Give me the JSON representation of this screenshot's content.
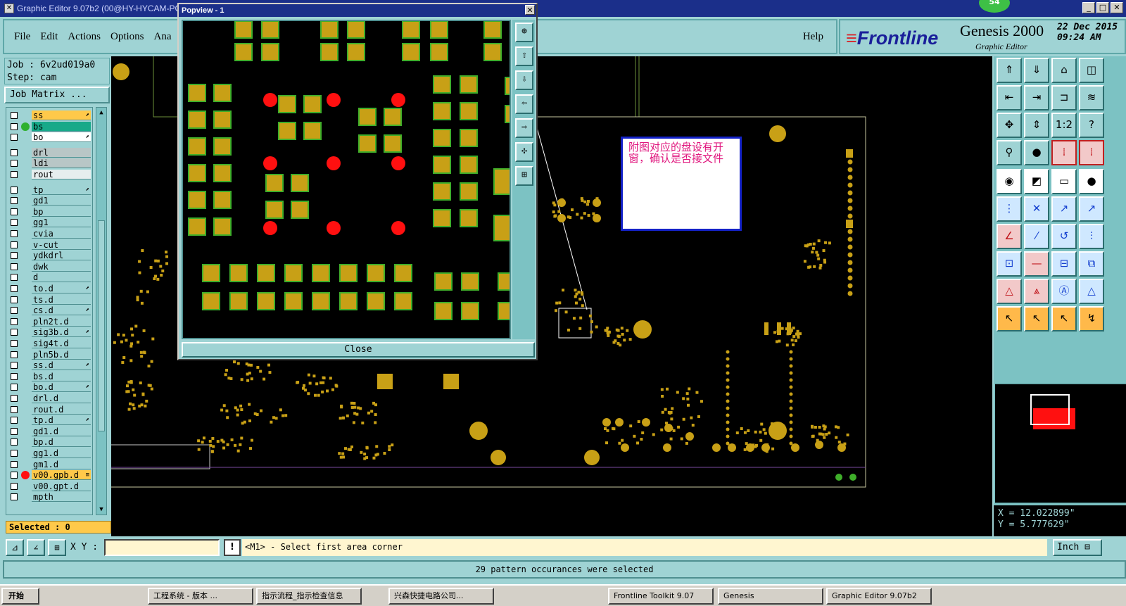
{
  "window": {
    "title": "Graphic Editor 9.07b2 (00@HY-HYCAM-PC",
    "minimize_icon": "minimize-icon",
    "maximize_icon": "maximize-icon",
    "close_icon": "close-icon",
    "notification_count": "54"
  },
  "menu": {
    "items": [
      "File",
      "Edit",
      "Actions",
      "Options",
      "Ana"
    ],
    "help": "Help"
  },
  "brand": {
    "logo": "Frontline",
    "product": "Genesis 2000",
    "subtitle": "Graphic Editor",
    "date": "22 Dec 2015",
    "time": "09:24 AM"
  },
  "job": {
    "job_line": "Job : 6v2ud019a0",
    "step_line": "Step: cam",
    "matrix_button": "Job Matrix ..."
  },
  "layers": [
    {
      "name": "ss",
      "color": "#ffc94a",
      "mark": "⬈"
    },
    {
      "name": "bs",
      "color": "#17a989",
      "dot": "#2fb02f"
    },
    {
      "name": "bo",
      "color": "#ffffff",
      "mark": "⬈"
    },
    {
      "name": "drl",
      "color": "#b8c6c6"
    },
    {
      "name": "ldi",
      "color": "#b8c6c6"
    },
    {
      "name": "rout",
      "color": "#e6eeee"
    },
    {
      "name": "tp",
      "color": "#9fd3d4",
      "mark": "⬈"
    },
    {
      "name": "gd1",
      "color": "#9fd3d4"
    },
    {
      "name": "bp",
      "color": "#9fd3d4"
    },
    {
      "name": "gg1",
      "color": "#9fd3d4"
    },
    {
      "name": "cvia",
      "color": "#9fd3d4"
    },
    {
      "name": "v-cut",
      "color": "#9fd3d4"
    },
    {
      "name": "ydkdrl",
      "color": "#9fd3d4"
    },
    {
      "name": "dwk",
      "color": "#9fd3d4"
    },
    {
      "name": "d",
      "color": "#9fd3d4"
    },
    {
      "name": "to.d",
      "color": "#9fd3d4",
      "mark": "⬈"
    },
    {
      "name": "ts.d",
      "color": "#9fd3d4"
    },
    {
      "name": "cs.d",
      "color": "#9fd3d4",
      "mark": "⬈"
    },
    {
      "name": "pln2t.d",
      "color": "#9fd3d4"
    },
    {
      "name": "sig3b.d",
      "color": "#9fd3d4",
      "mark": "⬈"
    },
    {
      "name": "sig4t.d",
      "color": "#9fd3d4"
    },
    {
      "name": "pln5b.d",
      "color": "#9fd3d4"
    },
    {
      "name": "ss.d",
      "color": "#9fd3d4",
      "mark": "⬈"
    },
    {
      "name": "bs.d",
      "color": "#9fd3d4"
    },
    {
      "name": "bo.d",
      "color": "#9fd3d4",
      "mark": "⬈"
    },
    {
      "name": "drl.d",
      "color": "#9fd3d4"
    },
    {
      "name": "rout.d",
      "color": "#9fd3d4"
    },
    {
      "name": "tp.d",
      "color": "#9fd3d4",
      "mark": "⬈"
    },
    {
      "name": "gd1.d",
      "color": "#9fd3d4"
    },
    {
      "name": "bp.d",
      "color": "#9fd3d4"
    },
    {
      "name": "gg1.d",
      "color": "#9fd3d4"
    },
    {
      "name": "gm1.d",
      "color": "#9fd3d4"
    },
    {
      "name": "v00.gpb.d",
      "color": "#ffc94a",
      "dot": "#ff1010",
      "mark": "≡"
    },
    {
      "name": "v00.gpt.d",
      "color": "#9fd3d4"
    },
    {
      "name": "mpth",
      "color": "#9fd3d4"
    }
  ],
  "selected_label": "Selected : 0",
  "popview": {
    "title": "Popview - 1",
    "close_label": "Close"
  },
  "annotation": "附图对应的盘设有开窗，确认是否接文件",
  "coords": {
    "x": "X = 12.022899\"",
    "y": "Y = 5.777629\""
  },
  "command": {
    "xy_label": "X Y :",
    "xy_value": "",
    "prompt": "<M1> - Select first area corner",
    "unit": "Inch"
  },
  "status": "29 pattern occurances were selected",
  "taskbar": {
    "start": "开始",
    "items": [
      "工程系统 - 版本 ...",
      "指示流程_指示检查信息",
      "兴森快捷电路公司...",
      "Frontline Toolkit 9.07",
      "Genesis",
      "Graphic Editor 9.07b2"
    ]
  },
  "colors": {
    "pad": "#c8a016",
    "pad_outline": "#3fae2a",
    "drill": "#ff1010",
    "panel": "#9fd3d4"
  }
}
